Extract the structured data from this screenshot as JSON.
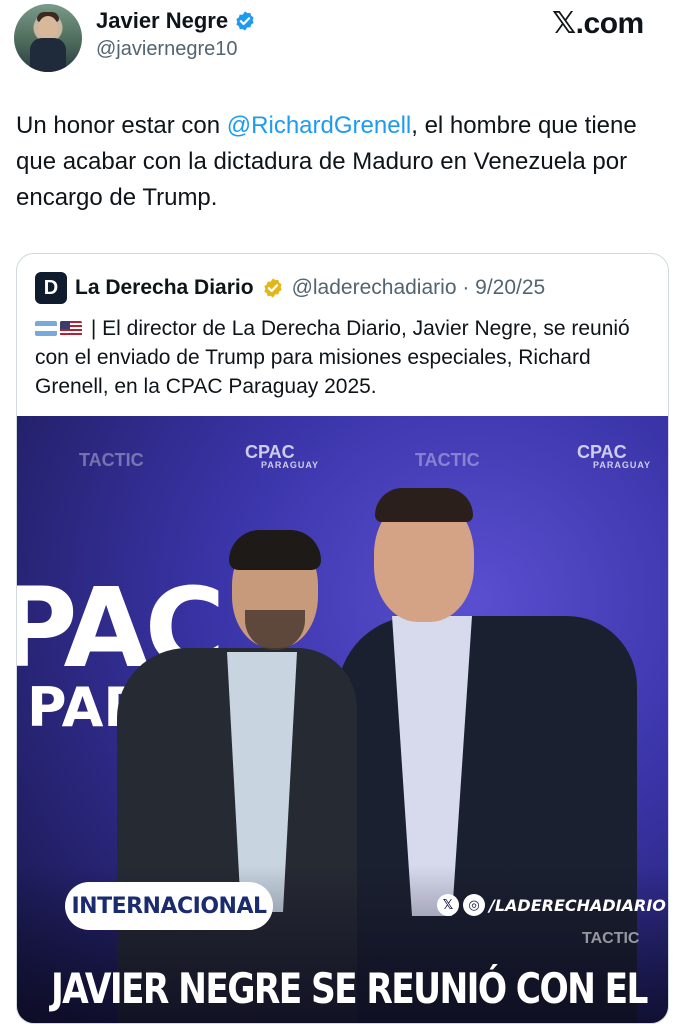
{
  "author": {
    "display_name": "Javier Negre",
    "handle": "@javiernegre10"
  },
  "brand": {
    "logo_text": "𝕏.com"
  },
  "tweet": {
    "text_before": "Un honor estar con ",
    "mention": "@RichardGrenell",
    "text_after": ", el hombre que tiene que acabar con la dictadura de Maduro en Venezuela por encargo de Trump."
  },
  "quote": {
    "logo_letter": "D",
    "name": "La Derecha Diario",
    "handle_date": "@laderechadiario · 9/20/25",
    "text": "| El director de La Derecha Diario, Javier Negre, se reunió con el enviado de Trump para misiones especiales, Richard Grenell, en la CPAC Paraguay 2025.",
    "image": {
      "backdrop_tactic": "TACTIC",
      "cpac_label": "CPAC",
      "cpac_sub": "PARAGUAY",
      "big_text_1": "PAC",
      "big_text_2": "PAR",
      "section_label": "INTERNACIONAL",
      "social_handle": "/LADERECHADIARIO",
      "social_icon_x": "𝕏",
      "social_icon_ig": "◎",
      "headline": "JAVIER NEGRE SE REUNIÓ CON EL"
    }
  },
  "colors": {
    "link": "#1d9bf0",
    "verified_blue": "#1d9bf0",
    "verified_gold": "#e2b719"
  }
}
